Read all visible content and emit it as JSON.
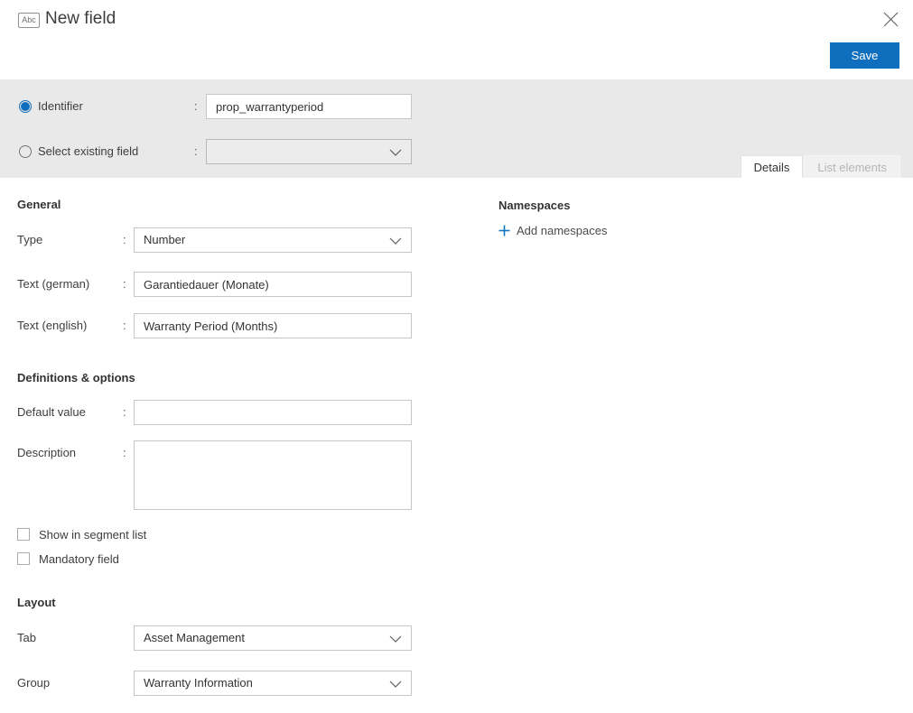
{
  "colors": {
    "accent": "#106ebe",
    "panel_bg": "#e9e9e9"
  },
  "header": {
    "type_badge": "Abc",
    "title": "New field",
    "save_label": "Save"
  },
  "panel": {
    "colon": ":",
    "identifier": {
      "label": "Identifier",
      "value": "prop_warrantyperiod",
      "selected": true
    },
    "existing_field": {
      "label": "Select existing field",
      "value": "",
      "selected": false
    },
    "tabs": {
      "details": "Details",
      "list_elements": "List elements",
      "active_tab": "Details"
    }
  },
  "main": {
    "general": {
      "heading": "General",
      "type": {
        "label": "Type",
        "value": "Number"
      },
      "text_german": {
        "label": "Text (german)",
        "value": "Garantiedauer (Monate)"
      },
      "text_english": {
        "label": "Text (english)",
        "value": "Warranty Period (Months)"
      }
    },
    "definitions": {
      "heading": "Definitions & options",
      "default_value": {
        "label": "Default value",
        "value": ""
      },
      "description": {
        "label": "Description",
        "value": ""
      },
      "show_in_segment_list": {
        "label": "Show in segment list",
        "checked": false
      },
      "mandatory_field": {
        "label": "Mandatory field",
        "checked": false
      }
    },
    "layout": {
      "heading": "Layout",
      "tab": {
        "label": "Tab",
        "value": "Asset Management"
      },
      "group": {
        "label": "Group",
        "value": "Warranty Information"
      }
    },
    "namespaces": {
      "heading": "Namespaces",
      "add_label": "Add namespaces"
    }
  }
}
